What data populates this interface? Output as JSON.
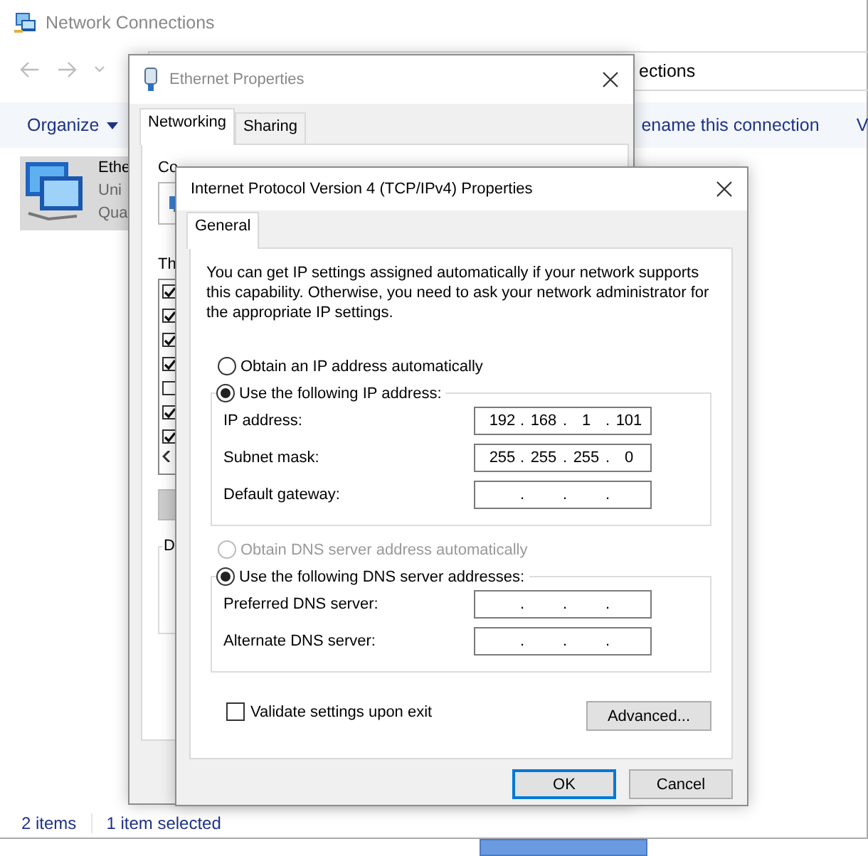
{
  "explorer": {
    "title": "Network Connections",
    "address_text": "ections",
    "toolbar": [
      {
        "label": "Organize",
        "kind": "menu"
      },
      {
        "label": "ename this connection",
        "kind": "command"
      },
      {
        "label": "V",
        "kind": "command"
      }
    ],
    "items": [
      {
        "lines": [
          "Ethe",
          "Uni",
          "Qua"
        ],
        "selected": true
      }
    ],
    "status_bar": [
      "2 items",
      "1 item selected"
    ]
  },
  "ethernet_dialog": {
    "title": "Ethernet Properties",
    "tabs": [
      {
        "label": "Networking",
        "selected": true
      },
      {
        "label": "Sharing",
        "selected": false
      }
    ],
    "connect_label": "Co",
    "components_label": "Th",
    "components": [
      {
        "checked": true
      },
      {
        "checked": true
      },
      {
        "checked": true
      },
      {
        "checked": true
      },
      {
        "checked": false
      },
      {
        "checked": true
      },
      {
        "checked": true
      }
    ],
    "group_label": "D"
  },
  "ipv4_dialog": {
    "title": "Internet Protocol Version 4 (TCP/IPv4) Properties",
    "tabs": [
      {
        "label": "General",
        "selected": true
      }
    ],
    "description": "You can get IP settings assigned automatically if your network supports this capability. Otherwise, you need to ask your network administrator for the appropriate IP settings.",
    "separator": ".",
    "ip_auto": {
      "label": "Obtain an IP address automatically",
      "selected": false,
      "disabled": false
    },
    "ip_manual": {
      "label": "Use the following IP address:",
      "selected": true,
      "disabled": false
    },
    "ip_fields": [
      {
        "label": "IP address:",
        "octets": [
          "192",
          "168",
          "1",
          "101"
        ]
      },
      {
        "label": "Subnet mask:",
        "octets": [
          "255",
          "255",
          "255",
          "0"
        ]
      },
      {
        "label": "Default gateway:"
      }
    ],
    "dns_auto": {
      "label": "Obtain DNS server address automatically",
      "selected": false,
      "disabled": true
    },
    "dns_manual": {
      "label": "Use the following DNS server addresses:",
      "selected": true,
      "disabled": false
    },
    "dns_fields": [
      {
        "label": "Preferred DNS server:"
      },
      {
        "label": "Alternate DNS server:"
      }
    ],
    "validate": {
      "label": "Validate settings upon exit",
      "checked": false
    },
    "advanced_button": "Advanced...",
    "buttons": [
      {
        "label": "OK",
        "default": true
      },
      {
        "label": "Cancel",
        "default": false
      }
    ]
  }
}
